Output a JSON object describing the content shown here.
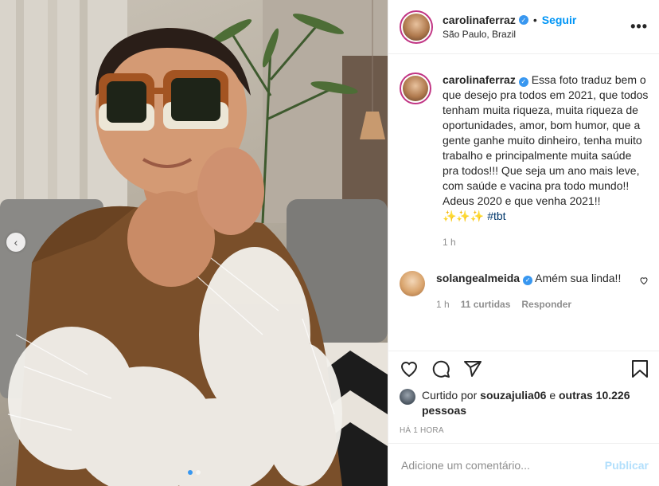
{
  "post": {
    "username": "carolinaferraz",
    "follow_label": "Seguir",
    "separator": "•",
    "location": "São Paulo, Brazil",
    "more_label": "•••",
    "carousel_prev": "‹"
  },
  "caption": {
    "username": "carolinaferraz",
    "text": "Essa foto traduz bem o que desejo pra todos em 2021, que todos tenham muita riqueza, muita riqueza de oportunidades, amor, bom humor, que a gente ganhe muito dinheiro, tenha muito trabalho e principalmente muita saúde pra todos!!! Que seja um ano mais leve, com saúde e vacina pra todo mundo!! Adeus 2020 e que venha 2021!!",
    "emoji": "✨✨✨",
    "hashtag": "#tbt",
    "age": "1 h"
  },
  "comment": {
    "username": "solangealmeida",
    "text": "Amém sua linda!!",
    "age": "1 h",
    "likes": "11 curtidas",
    "reply": "Responder"
  },
  "likes": {
    "prefix": "Curtido por",
    "user": "souzajulia06",
    "and": "e",
    "others": "outras 10.226 pessoas"
  },
  "timestamp": "HÁ 1 HORA",
  "add_comment": {
    "placeholder": "Adicione um comentário...",
    "post_label": "Publicar"
  },
  "colors": {
    "accent": "#0095f6",
    "verified": "#3897f0",
    "post_disabled": "#b2dffc"
  },
  "icons": [
    "heart-icon",
    "comment-icon",
    "share-icon",
    "bookmark-icon",
    "verified-icon",
    "more-icon"
  ]
}
